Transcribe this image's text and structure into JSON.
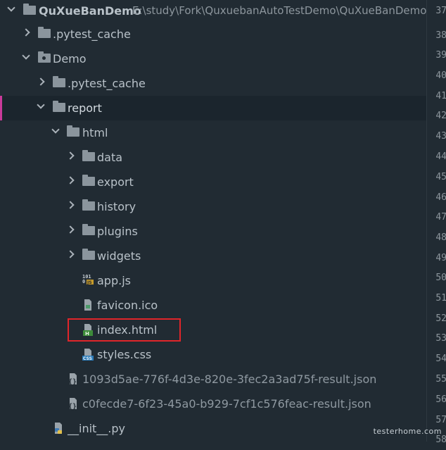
{
  "project": {
    "name": "QuXueBanDemo",
    "path": "E:\\study\\Fork\\QuxuebanAutoTestDemo\\QuXueBanDemo"
  },
  "tree": {
    "pytest_cache_root": ".pytest_cache",
    "demo": "Demo",
    "demo_pytest_cache": ".pytest_cache",
    "report": "report",
    "html": "html",
    "data": "data",
    "export": "export",
    "history": "history",
    "plugins": "plugins",
    "widgets": "widgets",
    "app_js": "app.js",
    "favicon": "favicon.ico",
    "index_html": "index.html",
    "styles_css": "styles.css",
    "result1": "1093d5ae-776f-4d3e-820e-3fec2a3ad75f-result.json",
    "result2": "c0fecde7-6f23-45a0-b929-7cf1c576feac-result.json",
    "init_py": "__init__.py"
  },
  "icons": {
    "folder": "folder-icon",
    "js": "js-file-icon",
    "image": "image-file-icon",
    "html": "html-file-icon",
    "css": "css-file-icon",
    "json": "json-file-icon",
    "python": "python-file-icon"
  },
  "line_numbers": [
    "37",
    "38",
    "39",
    "40",
    "41",
    "42",
    "43",
    "44",
    "45",
    "46",
    "47",
    "48",
    "49",
    "50",
    "51",
    "52",
    "53",
    "54",
    "55",
    "56",
    "57",
    "58"
  ],
  "highlighted_item": "index.html",
  "colors": {
    "background": "#212b33",
    "highlight_box": "#e0252a",
    "selection_marker": "#c93a9a"
  },
  "watermark": "testerhome.com"
}
